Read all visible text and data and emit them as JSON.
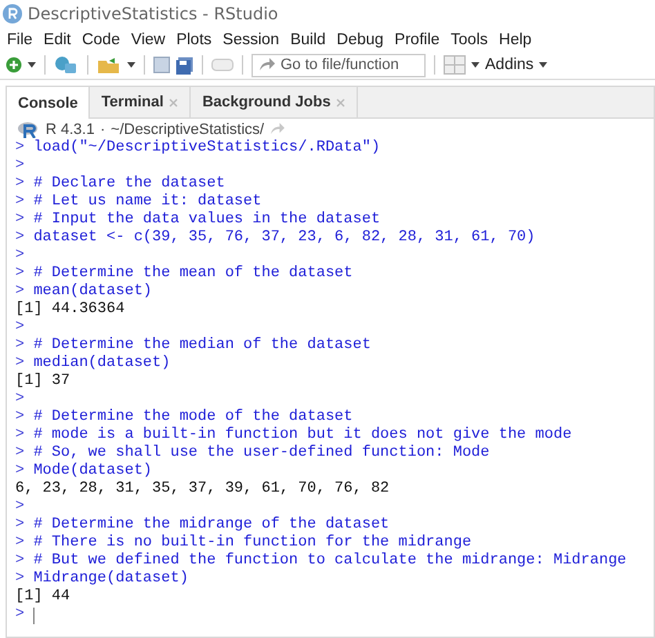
{
  "window": {
    "title": "DescriptiveStatistics - RStudio"
  },
  "menu": [
    "File",
    "Edit",
    "Code",
    "View",
    "Plots",
    "Session",
    "Build",
    "Debug",
    "Profile",
    "Tools",
    "Help"
  ],
  "toolbar": {
    "goto_placeholder": "Go to file/function",
    "addins": "Addins"
  },
  "tabs": [
    {
      "label": "Console",
      "selected": true,
      "closable": false
    },
    {
      "label": "Terminal",
      "selected": false,
      "closable": true
    },
    {
      "label": "Background Jobs",
      "selected": false,
      "closable": true
    }
  ],
  "console_header": {
    "version": "R 4.3.1",
    "separator": "·",
    "path": "~/DescriptiveStatistics/"
  },
  "lines": [
    {
      "kind": "input",
      "prompt": ">",
      "text": "load(\"~/DescriptiveStatistics/.RData\")"
    },
    {
      "kind": "input",
      "prompt": ">"
    },
    {
      "kind": "input",
      "prompt": ">",
      "text": "# Declare the dataset"
    },
    {
      "kind": "input",
      "prompt": ">",
      "text": "# Let us name it: dataset"
    },
    {
      "kind": "input",
      "prompt": ">",
      "text": "# Input the data values in the dataset"
    },
    {
      "kind": "input",
      "prompt": ">",
      "text": "dataset <- c(39, 35, 76, 37, 23, 6, 82, 28, 31, 61, 70)"
    },
    {
      "kind": "input",
      "prompt": ">"
    },
    {
      "kind": "input",
      "prompt": ">",
      "text": "# Determine the mean of the dataset"
    },
    {
      "kind": "input",
      "prompt": ">",
      "text": "mean(dataset)"
    },
    {
      "kind": "output",
      "text": "[1] 44.36364"
    },
    {
      "kind": "input",
      "prompt": ">"
    },
    {
      "kind": "input",
      "prompt": ">",
      "text": "# Determine the median of the dataset"
    },
    {
      "kind": "input",
      "prompt": ">",
      "text": "median(dataset)"
    },
    {
      "kind": "output",
      "text": "[1] 37"
    },
    {
      "kind": "input",
      "prompt": ">"
    },
    {
      "kind": "input",
      "prompt": ">",
      "text": "# Determine the mode of the dataset"
    },
    {
      "kind": "input",
      "prompt": ">",
      "text": "# mode is a built-in function but it does not give the mode"
    },
    {
      "kind": "input",
      "prompt": ">",
      "text": "# So, we shall use the user-defined function: Mode"
    },
    {
      "kind": "input",
      "prompt": ">",
      "text": "Mode(dataset)"
    },
    {
      "kind": "output",
      "text": "6, 23, 28, 31, 35, 37, 39, 61, 70, 76, 82"
    },
    {
      "kind": "input",
      "prompt": ">"
    },
    {
      "kind": "input",
      "prompt": ">",
      "text": "# Determine the midrange of the dataset"
    },
    {
      "kind": "input",
      "prompt": ">",
      "text": "# There is no built-in function for the midrange"
    },
    {
      "kind": "input",
      "prompt": ">",
      "text": "# But we defined the function to calculate the midrange: Midrange"
    },
    {
      "kind": "input",
      "prompt": ">",
      "text": "Midrange(dataset)"
    },
    {
      "kind": "output",
      "text": "[1] 44"
    },
    {
      "kind": "cursor",
      "prompt": ">"
    }
  ]
}
